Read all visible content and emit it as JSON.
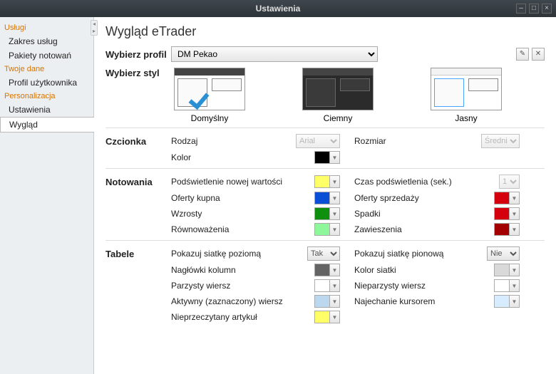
{
  "window": {
    "title": "Ustawienia"
  },
  "sidebar": {
    "groups": [
      {
        "header": "Usługi",
        "items": [
          "Zakres usług",
          "Pakiety notowań"
        ]
      },
      {
        "header": "Twoje dane",
        "items": [
          "Profil użytkownika"
        ]
      },
      {
        "header": "Personalizacja",
        "items": [
          "Ustawienia",
          "Wygląd"
        ],
        "selected": "Wygląd"
      }
    ]
  },
  "page": {
    "title": "Wygląd eTrader",
    "profile_label": "Wybierz profil",
    "profile_value": "DM Pekao",
    "style_label": "Wybierz styl",
    "styles": {
      "default": "Domyślny",
      "dark": "Ciemny",
      "light": "Jasny"
    },
    "font": {
      "section": "Czcionka",
      "family_label": "Rodzaj",
      "family_value": "Arial",
      "size_label": "Rozmiar",
      "size_value": "Średni",
      "color_label": "Kolor",
      "color_value": "#000000"
    },
    "quotes": {
      "section": "Notowania",
      "hl_label": "Podświetlenie nowej wartości",
      "hl_color": "#ffff66",
      "hl_time_label": "Czas podświetlenia (sek.)",
      "hl_time_value": "1",
      "bid_label": "Oferty kupna",
      "bid_color": "#0b4fd6",
      "ask_label": "Oferty sprzedaży",
      "ask_color": "#d4000e",
      "up_label": "Wzrosty",
      "up_color": "#0e8f0e",
      "down_label": "Spadki",
      "down_color": "#d4000e",
      "bal_label": "Równoważenia",
      "bal_color": "#8ef79a",
      "susp_label": "Zawieszenia",
      "susp_color": "#a20000"
    },
    "tables": {
      "section": "Tabele",
      "hgrid_label": "Pokazuj siatkę poziomą",
      "hgrid_value": "Tak",
      "vgrid_label": "Pokazuj siatkę pionową",
      "vgrid_value": "Nie",
      "head_label": "Nagłówki kolumn",
      "head_color": "#646464",
      "grid_color_label": "Kolor siatki",
      "grid_color": "#d9d9d9",
      "even_label": "Parzysty wiersz",
      "even_color": "#ffffff",
      "odd_label": "Nieparzysty wiersz",
      "odd_color": "#ffffff",
      "active_label": "Aktywny (zaznaczony) wiersz",
      "active_color": "#bcd8ef",
      "hover_label": "Najechanie kursorem",
      "hover_color": "#d7ecff",
      "unread_label": "Nieprzeczytany artykuł",
      "unread_color": "#ffff66"
    }
  }
}
